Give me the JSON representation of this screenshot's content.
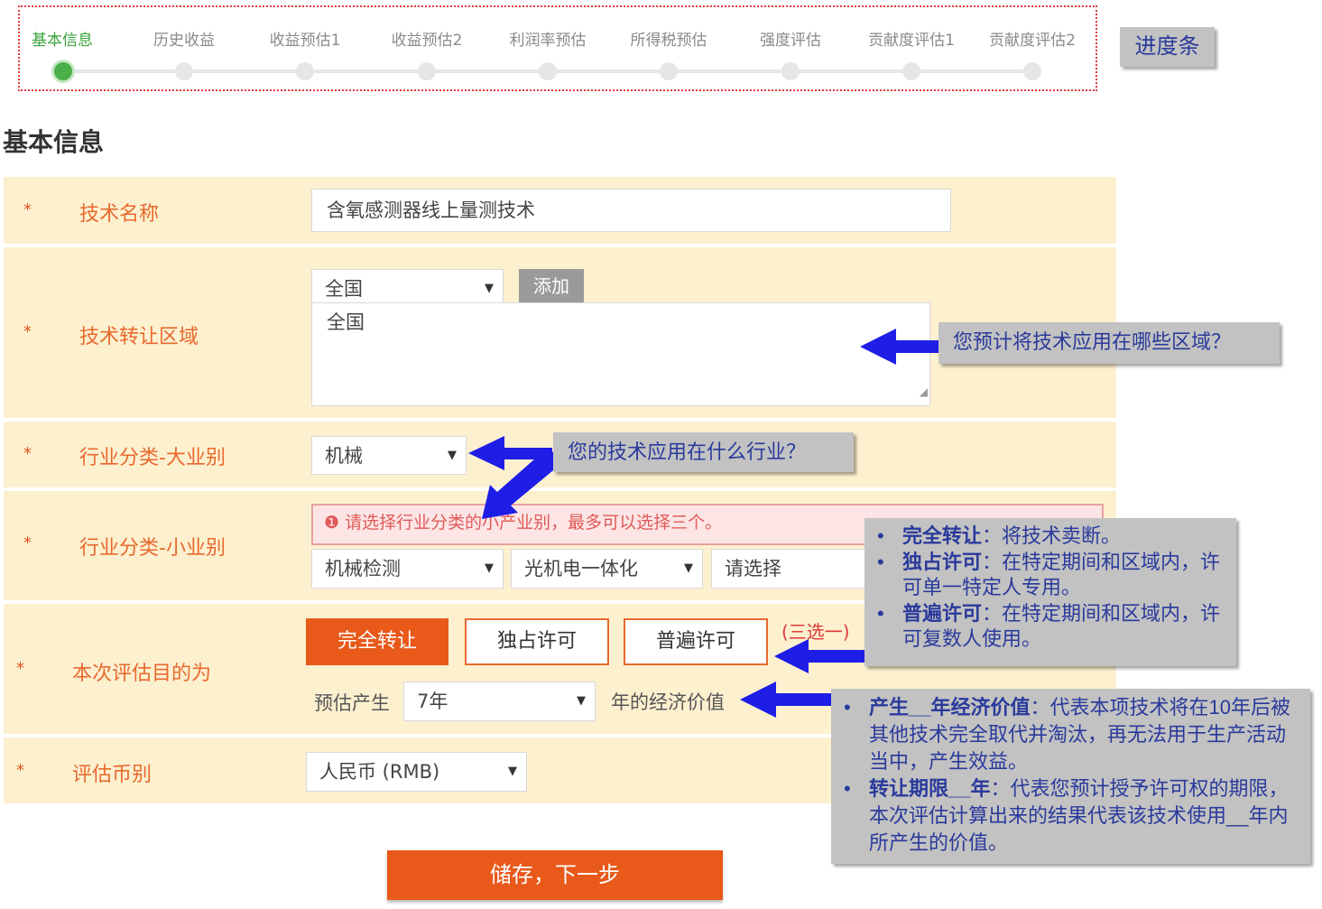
{
  "progress": {
    "steps": [
      "基本信息",
      "历史收益",
      "收益预估1",
      "收益预估2",
      "利润率预估",
      "所得税预估",
      "强度评估",
      "贡献度评估1",
      "贡献度评估2"
    ],
    "active_index": 0,
    "callout": "进度条"
  },
  "page_title": "基本信息",
  "form": {
    "required_mark": "*",
    "tech_name": {
      "label": "技术名称",
      "value": "含氧感测器线上量测技术"
    },
    "region": {
      "label": "技术转让区域",
      "select_value": "全国",
      "add_button": "添加",
      "list_value": "全国"
    },
    "industry_major": {
      "label": "行业分类-大业别",
      "value": "机械"
    },
    "industry_minor": {
      "label": "行业分类-小业别",
      "error": "请选择行业分类的小产业别，最多可以选择三个。",
      "selects": [
        "机械检测",
        "光机电一体化",
        "请选择"
      ]
    },
    "purpose": {
      "label": "本次评估目的为",
      "options": [
        "完全转让",
        "独占许可",
        "普遍许可"
      ],
      "selected": "完全转让",
      "hint": "(三选一)",
      "years_prefix": "预估产生",
      "years_value": "7年",
      "years_suffix": "年的经济价值"
    },
    "currency": {
      "label": "评估币别",
      "value": "人民币 (RMB)"
    }
  },
  "save_button": "储存，下一步",
  "annotations": {
    "region_q": "您预计将技术应用在哪些区域？",
    "industry_q": "您的技术应用在什么行业？",
    "license_terms": [
      {
        "term": "完全转让",
        "desc": "：将技术卖断。"
      },
      {
        "term": "独占许可",
        "desc": "：在特定期间和区域内，许可单一特定人专用。"
      },
      {
        "term": "普遍许可",
        "desc": "：在特定期间和区域内，许可复数人使用。"
      }
    ],
    "year_terms": [
      {
        "term": "产生__年经济价值",
        "desc": "：代表本项技术将在10年后被其他技术完全取代并淘汰，再无法用于生产活动当中，产生效益。"
      },
      {
        "term": "转让期限__年",
        "desc": "：代表您预计授予许可权的期限，本次评估计算出来的结果代表该技术使用__年内所产生的价值。"
      }
    ]
  },
  "colors": {
    "accent": "#e8591a",
    "label": "#e8692e",
    "row_bg": "#fdf0cf",
    "active_step": "#4cb04a",
    "callout_text": "#2a3a9c",
    "arrow": "#1e1ee6"
  }
}
